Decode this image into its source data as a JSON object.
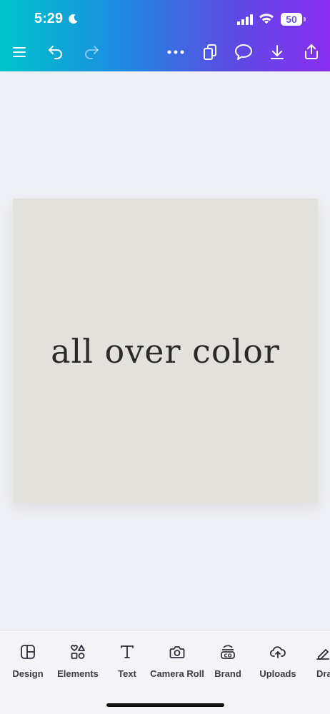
{
  "status_bar": {
    "time": "5:29",
    "battery": "50"
  },
  "toolbar": {
    "icons": [
      "menu-icon",
      "undo-icon",
      "redo-icon",
      "more-icon",
      "pages-icon",
      "comment-icon",
      "download-icon",
      "share-icon"
    ]
  },
  "canvas": {
    "design_text": "all over color",
    "background_color": "#e3e1dc"
  },
  "bottom_nav": {
    "items": [
      {
        "label": "Design",
        "icon": "design-icon"
      },
      {
        "label": "Elements",
        "icon": "elements-icon"
      },
      {
        "label": "Text",
        "icon": "text-icon"
      },
      {
        "label": "Camera Roll",
        "icon": "camera-icon"
      },
      {
        "label": "Brand",
        "icon": "brand-icon"
      },
      {
        "label": "Uploads",
        "icon": "uploads-icon"
      },
      {
        "label": "Dra",
        "icon": "draw-icon"
      }
    ]
  },
  "colors": {
    "gradient_start": "#00c4cc",
    "gradient_end": "#8a2ef0"
  }
}
